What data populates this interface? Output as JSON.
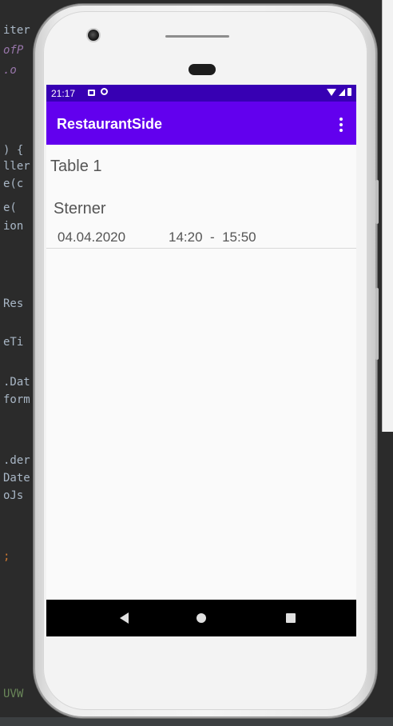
{
  "background_code": {
    "lines": [
      "iter",
      "ofP",
      ".o",
      ") {",
      "ller",
      "e(c",
      "e(",
      "ion",
      "Res",
      "eTi",
      ".Dat",
      "form",
      ".der",
      "Date",
      "oJs",
      "; ",
      "UVW"
    ]
  },
  "status_bar": {
    "time": "21:17"
  },
  "app_bar": {
    "title": "RestaurantSide",
    "overflow_icon": "more-vert-icon"
  },
  "table": {
    "title": "Table 1"
  },
  "reservations": [
    {
      "name": "Sterner",
      "date": "04.04.2020",
      "times": "14:20  -  15:50"
    }
  ],
  "nav_bar": {
    "back_icon": "back-triangle-icon",
    "home_icon": "home-circle-icon",
    "recents_icon": "recents-square-icon"
  },
  "colors": {
    "status_bar": "#3700b3",
    "app_bar": "#6200ee",
    "screen_bg": "#fafafa",
    "text": "#555555"
  }
}
